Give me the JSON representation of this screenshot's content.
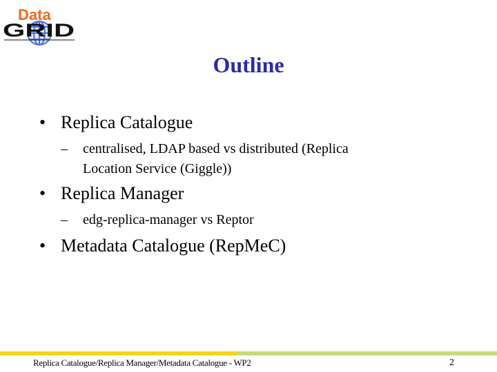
{
  "logo": {
    "top_word": "Data",
    "bottom_word": "GRID",
    "icon": "globe-icon",
    "colors": {
      "data": "#f06a1c",
      "grid": "#111111",
      "globe": "#4a6fd8"
    }
  },
  "slide": {
    "title": "Outline",
    "title_color": "#2b2ba8",
    "bullets": [
      {
        "marker": "•",
        "text": "Replica Catalogue",
        "sub": [
          {
            "marker": "–",
            "line1": "centralised, LDAP based vs distributed (Replica",
            "line2": "Location Service (Giggle))"
          }
        ]
      },
      {
        "marker": "•",
        "text": "Replica Manager",
        "sub": [
          {
            "marker": "–",
            "line1": "edg-replica-manager vs Reptor"
          }
        ]
      },
      {
        "marker": "•",
        "text": "Metadata Catalogue (RepMeC)",
        "sub": []
      }
    ]
  },
  "footer": {
    "text": "Replica Catalogue/Replica Manager/Metadata Catalogue - WP2",
    "page_number": "2",
    "bar_colors": {
      "left": "#f3d418",
      "right": "#c5dc78"
    }
  }
}
